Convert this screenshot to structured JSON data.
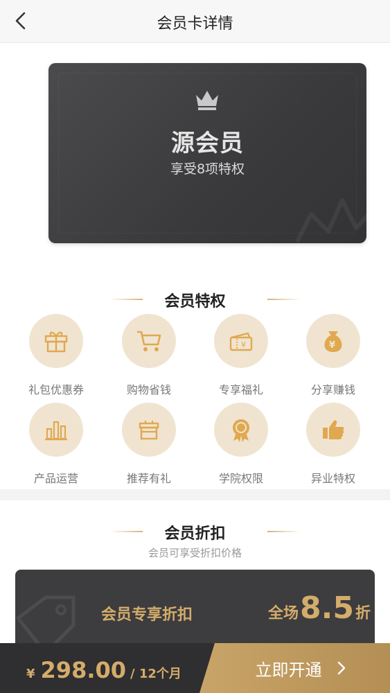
{
  "header": {
    "title": "会员卡详情",
    "back_icon": "chevron-left-icon"
  },
  "card": {
    "name": "源会员",
    "subtitle": "享受8项特权",
    "icon": "crown-icon"
  },
  "privileges": {
    "title": "会员特权",
    "items": [
      {
        "label": "礼包优惠券",
        "icon": "gift-icon"
      },
      {
        "label": "购物省钱",
        "icon": "cart-icon"
      },
      {
        "label": "专享福礼",
        "icon": "ticket-icon"
      },
      {
        "label": "分享赚钱",
        "icon": "money-bag-icon"
      },
      {
        "label": "产品运营",
        "icon": "bar-chart-icon"
      },
      {
        "label": "推荐有礼",
        "icon": "gift-box-icon"
      },
      {
        "label": "学院权限",
        "icon": "award-icon"
      },
      {
        "label": "异业特权",
        "icon": "thumbs-up-icon"
      }
    ]
  },
  "discount": {
    "title": "会员折扣",
    "subtitle": "会员可享受折扣价格",
    "label": "会员专享折扣",
    "prefix": "全场",
    "value": "8.5",
    "suffix": "折"
  },
  "bottom_bar": {
    "currency": "¥",
    "price": "298.00",
    "period": "/ 12个月",
    "button_label": "立即开通"
  },
  "colors": {
    "gold": "#d4ac6b",
    "dark": "#3d3c3e",
    "icon_bg": "#f0e4d0"
  }
}
